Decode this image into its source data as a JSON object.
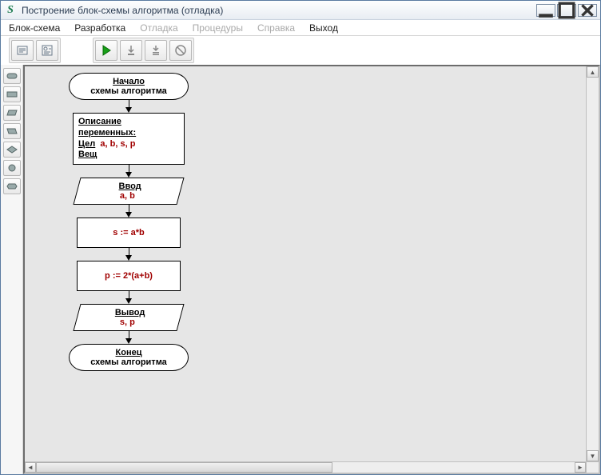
{
  "window": {
    "title": "Построение блок-схемы алгоритма (отладка)",
    "app_icon_glyph": "S"
  },
  "menu": {
    "items": [
      {
        "label": "Блок-схема",
        "enabled": true
      },
      {
        "label": "Разработка",
        "enabled": true
      },
      {
        "label": "Отладка",
        "enabled": false
      },
      {
        "label": "Процедуры",
        "enabled": false
      },
      {
        "label": "Справка",
        "enabled": false
      },
      {
        "label": "Выход",
        "enabled": true
      }
    ]
  },
  "toolbar": {
    "group1": [
      "edit-scheme",
      "view-scheme"
    ],
    "group2": [
      "run",
      "step-into",
      "step-to-cursor",
      "stop"
    ]
  },
  "palette": {
    "tools": [
      "terminator-shape",
      "process-shape",
      "io-shape",
      "io-shape-alt",
      "decision-shape",
      "connector-shape",
      "loop-shape"
    ]
  },
  "flowchart": {
    "start": {
      "line1": "Начало",
      "line2": "схемы алгоритма"
    },
    "declarations": {
      "header": "Описание переменных:",
      "int_label": "Цел",
      "int_vars": "a, b, s, p",
      "real_label": "Вещ"
    },
    "input": {
      "title": "Ввод",
      "vars": "a, b"
    },
    "proc1": {
      "expr": "s := a*b"
    },
    "proc2": {
      "expr": "p := 2*(a+b)"
    },
    "output": {
      "title": "Вывод",
      "vars": "s, p"
    },
    "end": {
      "line1": "Конец",
      "line2": "схемы алгоритма"
    }
  }
}
